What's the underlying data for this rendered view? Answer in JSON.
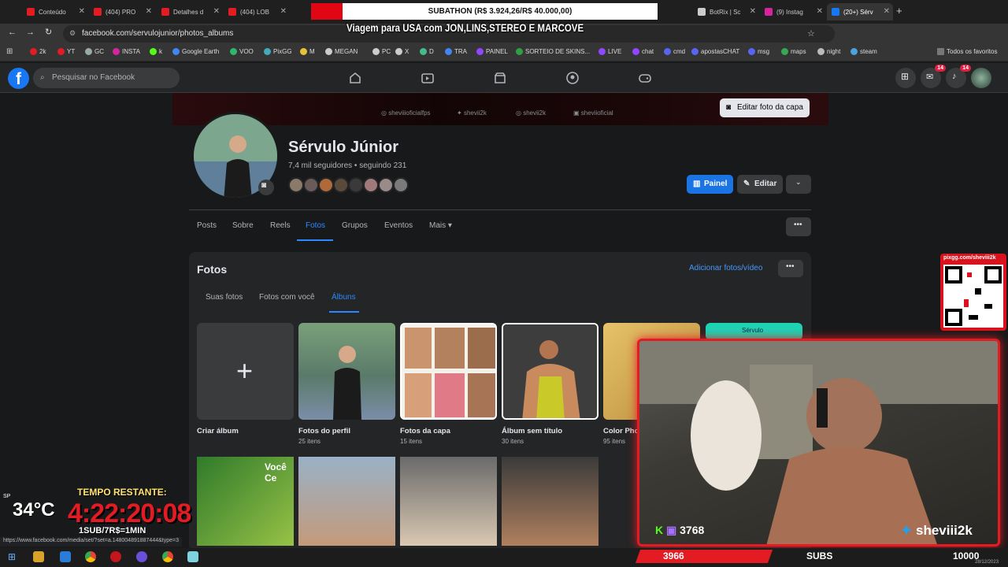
{
  "browser": {
    "tabs": [
      {
        "label": "Conteúdo",
        "color": "#e31b23"
      },
      {
        "label": "(404) PRO",
        "color": "#e31b23"
      },
      {
        "label": "Detalhes d",
        "color": "#e31b23"
      },
      {
        "label": "(404) LOB",
        "color": "#e31b23"
      },
      {
        "label": "BotRix | Sc",
        "color": "#cccccc"
      },
      {
        "label": "(9) Instag",
        "color": "#d6249f"
      },
      {
        "label": "(20+) Sérv",
        "color": "#1877f2"
      }
    ],
    "url": "facebook.com/servulojunior/photos_albums",
    "bookmarks": [
      "2k",
      "YT",
      "GC",
      "INSTA",
      "k",
      "Google Earth",
      "VOO",
      "PixGG",
      "M",
      "MEGAN",
      "PC",
      "X",
      "D",
      "TRA",
      "PAINEL",
      "SORTEIO DE SKINS...",
      "LIVE",
      "chat",
      "cmd",
      "apostasCHAT",
      "msg",
      "maps",
      "night",
      "steam"
    ],
    "all_favorites": "Todos os favoritos"
  },
  "facebook": {
    "search_placeholder": "Pesquisar no Facebook",
    "badge_messenger": "14",
    "badge_notifications": "14",
    "edit_cover": "Editar foto da capa",
    "social_links": [
      "sheviiioficialfps",
      "shevii2k",
      "shevii2k",
      "sheviioficial"
    ],
    "profile_name": "Sérvulo Júnior",
    "profile_meta": "7,4 mil seguidores • seguindo 231",
    "btn_panel": "Painel",
    "btn_edit": "Editar",
    "tabs": [
      "Posts",
      "Sobre",
      "Reels",
      "Fotos",
      "Grupos",
      "Eventos",
      "Mais"
    ],
    "active_tab": "Fotos",
    "photos_title": "Fotos",
    "add_photos": "Adicionar fotos/vídeo",
    "sub_tabs": [
      "Suas fotos",
      "Fotos com você",
      "Álbuns"
    ],
    "active_sub_tab": "Álbuns",
    "albums": [
      {
        "name": "Criar álbum",
        "count": ""
      },
      {
        "name": "Fotos do perfil",
        "count": "25 itens"
      },
      {
        "name": "Fotos da capa",
        "count": "15 itens"
      },
      {
        "name": "Álbum sem título",
        "count": "30 itens"
      },
      {
        "name": "Color Pho",
        "count": "95 itens"
      },
      {
        "name": "Sérvulo",
        "count": ""
      }
    ],
    "row2_text": "Você Ce"
  },
  "stream": {
    "subathon": "SUBATHON (R$ 3.924,26/R$ 40.000,00)",
    "trip_title": "Viagem para USA com JON,LINS,STEREO E MARCOVE",
    "qr_url": "pixgg.com/sheviii2k",
    "temp_location": "SP",
    "temperature": "34°C",
    "tempo_label": "TEMPO RESTANTE:",
    "timer": "4:22:20:08",
    "sub_rate": "1SUB/7R$=1MIN",
    "status_url": "https://www.facebook.com/media/set/?set=a.148004891887444&type=3",
    "kick_count": "3768",
    "twitter_handle": "sheviii2k",
    "bar_count": "3966",
    "subs_label": "SUBS",
    "subs_count": "10000",
    "date": "28/12/2023"
  }
}
